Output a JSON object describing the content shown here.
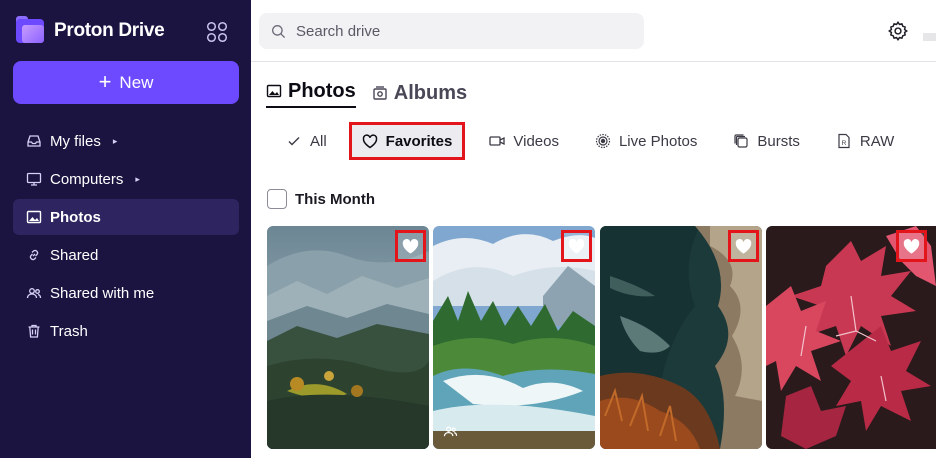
{
  "brand": {
    "name": "Proton Drive"
  },
  "sidebar": {
    "new_label": "New",
    "items": [
      {
        "label": "My files",
        "icon": "inbox-icon",
        "caret": "▸"
      },
      {
        "label": "Computers",
        "icon": "monitor-icon",
        "caret": "▸"
      },
      {
        "label": "Photos",
        "icon": "image-icon",
        "active": true
      },
      {
        "label": "Shared",
        "icon": "link-icon"
      },
      {
        "label": "Shared with me",
        "icon": "users-icon"
      },
      {
        "label": "Trash",
        "icon": "trash-icon"
      }
    ]
  },
  "search": {
    "placeholder": "Search drive"
  },
  "tabs": [
    {
      "label": "Photos",
      "icon": "image-icon",
      "active": true
    },
    {
      "label": "Albums",
      "icon": "album-icon"
    }
  ],
  "filters": [
    {
      "label": "All",
      "icon": "check-icon"
    },
    {
      "label": "Favorites",
      "icon": "heart-outline-icon",
      "active": true
    },
    {
      "label": "Videos",
      "icon": "video-icon"
    },
    {
      "label": "Live Photos",
      "icon": "live-photo-icon"
    },
    {
      "label": "Bursts",
      "icon": "bursts-icon"
    },
    {
      "label": "RAW",
      "icon": "raw-file-icon"
    }
  ],
  "section": {
    "label": "This Month"
  },
  "photos": [
    {
      "subject": "mountain-forest-valley",
      "favorite": true
    },
    {
      "subject": "waterfall-forest",
      "favorite": true,
      "shared": true
    },
    {
      "subject": "rocky-coast",
      "favorite": true
    },
    {
      "subject": "pink-leaves",
      "favorite": true
    }
  ],
  "colors": {
    "sidebar_bg": "#1b1340",
    "accent": "#6d4aff",
    "active_nav_bg": "#2e2560",
    "highlight": "#e4141b"
  }
}
